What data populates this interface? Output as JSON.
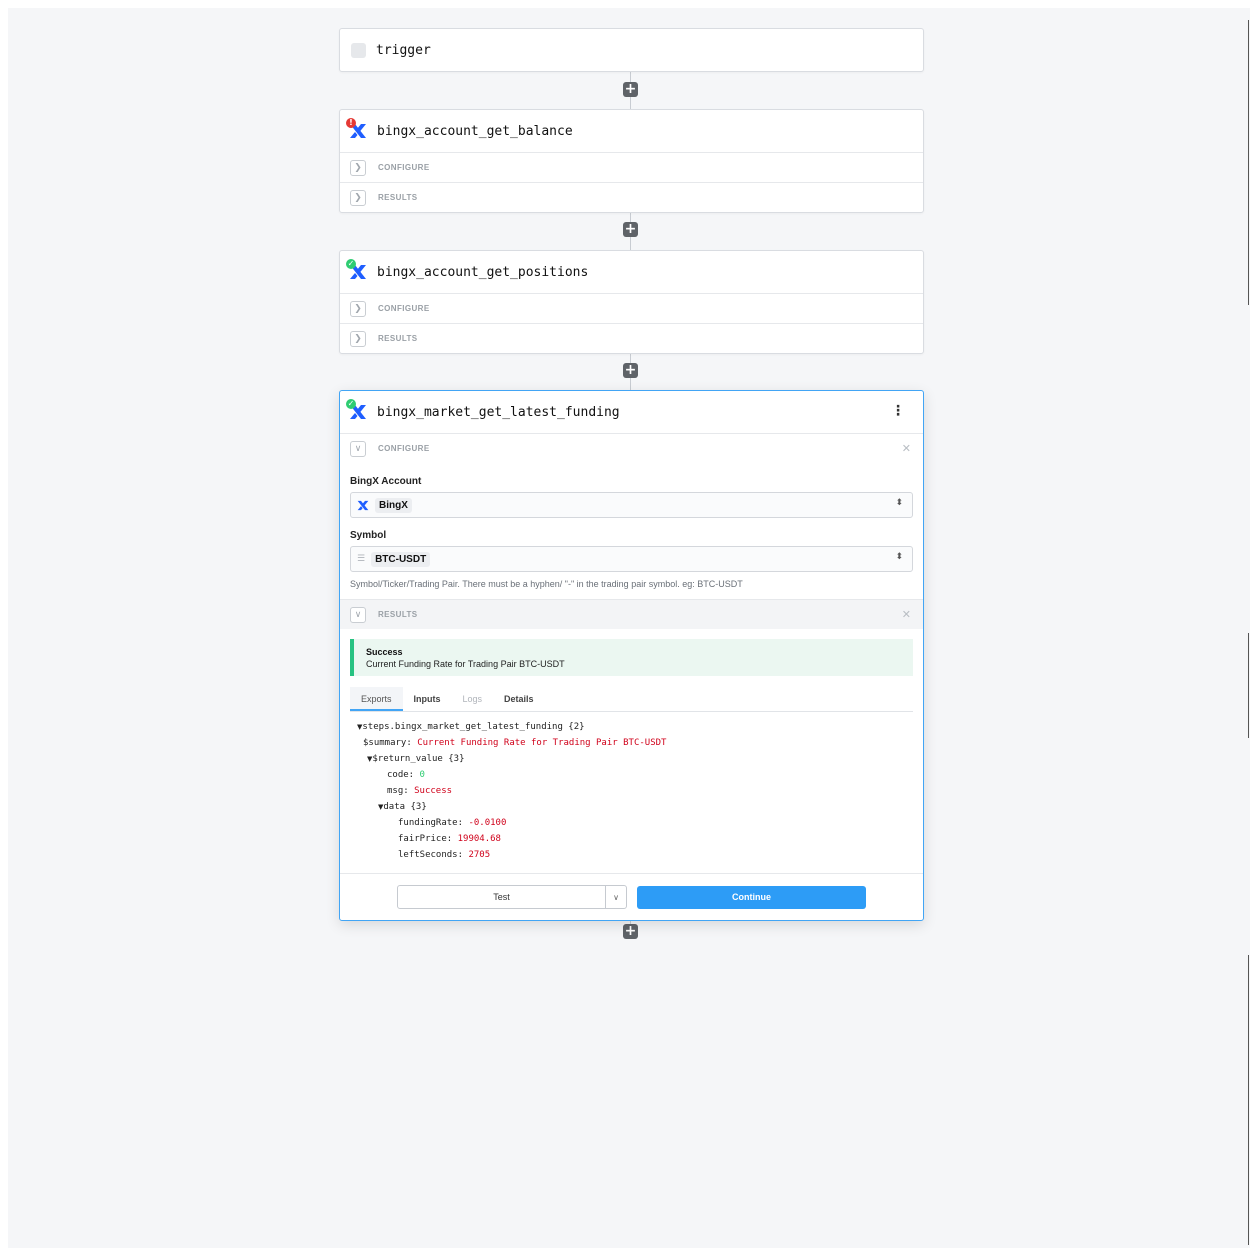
{
  "steps": [
    {
      "title": "trigger"
    },
    {
      "title": "bingx_account_get_balance",
      "status": "error",
      "sections": [
        "CONFIGURE",
        "RESULTS"
      ]
    },
    {
      "title": "bingx_account_get_positions",
      "status": "success",
      "sections": [
        "CONFIGURE",
        "RESULTS"
      ]
    }
  ],
  "active_step": {
    "title": "bingx_market_get_latest_funding",
    "status": "success",
    "configure_label": "CONFIGURE",
    "account_label": "BingX Account",
    "account_value": "BingX",
    "symbol_label": "Symbol",
    "symbol_value": "BTC-USDT",
    "symbol_hint": "Symbol/Ticker/Trading Pair. There must be a hyphen/ \"-\" in the trading pair symbol. eg: BTC-USDT",
    "results_label": "RESULTS",
    "result_title": "Success",
    "result_message": "Current Funding Rate for Trading Pair BTC-USDT",
    "tabs": [
      "Exports",
      "Inputs",
      "Logs",
      "Details"
    ],
    "tree": {
      "root": "steps.bingx_market_get_latest_funding {2}",
      "summary_key": "$summary:",
      "summary_value": "Current Funding Rate for Trading Pair BTC-USDT",
      "return_key": "$return_value {3}",
      "code_key": "code:",
      "code_value": "0",
      "msg_key": "msg:",
      "msg_value": "Success",
      "data_key": "data {3}",
      "fundingRate_key": "fundingRate:",
      "fundingRate_value": "-0.0100",
      "fairPrice_key": "fairPrice:",
      "fairPrice_value": "19904.68",
      "leftSeconds_key": "leftSeconds:",
      "leftSeconds_value": "2705"
    },
    "test_label": "Test",
    "continue_label": "Continue"
  },
  "icons": {
    "add": "plus-icon",
    "expand": "chevron-right-icon",
    "collapse": "chevron-down-icon",
    "pin": "pin-icon",
    "menu": "kebab-menu-icon",
    "app": "bingx-logo-icon",
    "list": "list-icon",
    "select_arrows": "updown-arrows-icon"
  },
  "colors": {
    "accent": "#2d9cf6",
    "success": "#27c281",
    "error": "#e53935",
    "string_value": "#d0021b",
    "number_value": "#2ecc71"
  }
}
